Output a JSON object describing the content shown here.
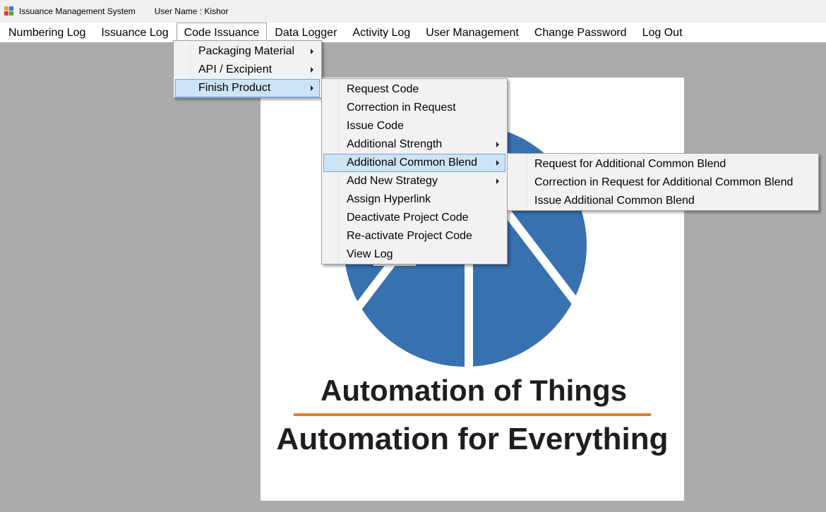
{
  "window": {
    "app_title": "Issuance Management System",
    "user_label": "User Name : Kishor"
  },
  "menubar": {
    "items": [
      {
        "label": "Numbering Log"
      },
      {
        "label": "Issuance Log"
      },
      {
        "label": "Code Issuance"
      },
      {
        "label": "Data Logger"
      },
      {
        "label": "Activity Log"
      },
      {
        "label": "User Management"
      },
      {
        "label": "Change Password"
      },
      {
        "label": "Log Out"
      }
    ]
  },
  "code_issuance_menu": {
    "items": [
      {
        "label": "Packaging Material",
        "has_submenu": true
      },
      {
        "label": "API / Excipient",
        "has_submenu": true
      },
      {
        "label": "Finish Product",
        "has_submenu": true,
        "highlighted": true
      }
    ]
  },
  "finish_product_menu": {
    "items": [
      {
        "label": "Request Code"
      },
      {
        "label": "Correction in Request"
      },
      {
        "label": "Issue Code"
      },
      {
        "label": "Additional Strength",
        "has_submenu": true
      },
      {
        "label": "Additional Common Blend",
        "has_submenu": true,
        "highlighted": true
      },
      {
        "label": "Add New Strategy",
        "has_submenu": true
      },
      {
        "label": "Assign Hyperlink"
      },
      {
        "label": "Deactivate Project Code"
      },
      {
        "label": "Re-activate Project Code"
      },
      {
        "label": "View Log"
      }
    ]
  },
  "additional_common_blend_menu": {
    "items": [
      {
        "label": "Request for Additional Common Blend"
      },
      {
        "label": "Correction in Request for Additional Common Blend"
      },
      {
        "label": "Issue Additional Common Blend"
      }
    ]
  },
  "poster": {
    "line1": "Automation of Things",
    "line2": "Automation for Everything",
    "logo_color": "#3771b0",
    "accent_color": "#e67e22"
  }
}
